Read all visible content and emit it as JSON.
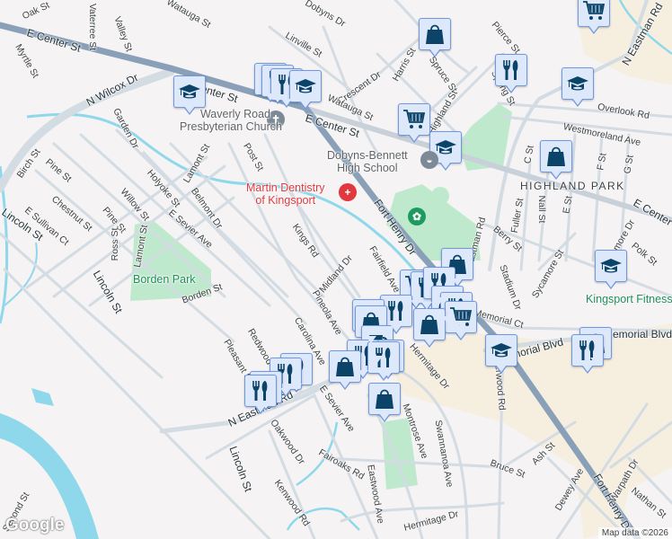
{
  "map": {
    "colors": {
      "background": "#f5f3f3",
      "major_road": "#8aa0b8",
      "minor_road": "#d3dbe3",
      "water": "#8fd8ec",
      "park": "#bfe9cc",
      "commercial": "#f6efe0",
      "marker_bg": "#dde8fb",
      "marker_border": "#6f98e0",
      "marker_icon": "#0b4468"
    },
    "street_labels": [
      "Oak St",
      "Vaterree St",
      "Valley St",
      "Myrtle St",
      "E Center St",
      "N Wilcox Dr",
      "Garden Dr",
      "Center St",
      "Watauga St",
      "Dobyns Dr",
      "Linville St",
      "E Center St",
      "Lamont St",
      "Post St",
      "Birch St",
      "Pine St",
      "Chestnut St",
      "E Sullivan Ct",
      "Lincoln St",
      "Pine St",
      "Willow St",
      "Holyoke St",
      "Belmont Dr",
      "E Sevier Ave",
      "Ross St",
      "Lamont St",
      "Kings Rd",
      "Midland Dr",
      "Borden St",
      "Lincoln St",
      "Crescent Dr",
      "Harris St",
      "Spruce St",
      "Pierce St",
      "Spring St",
      "Watauga St",
      "Highland St",
      "Overlook Rd",
      "Westmoreland Ave",
      "C St",
      "F St",
      "G St",
      "Fuller St",
      "Nall St",
      "E St",
      "Berry St",
      "Fort Henry Dr",
      "Eastman Rd",
      "N Eastman Rd",
      "E Center St",
      "Kenmore Dr",
      "Polk St",
      "Sycamore St",
      "Stadium Dr",
      "Memorial Ct",
      "Memorial Blvd",
      "Memorial Blvd",
      "Fairfield Ave",
      "Pineola Ave",
      "Carolina Ave",
      "Hermitage Dr",
      "Redwood Dr",
      "Pleasant St",
      "N Eastman Rd",
      "E Sevier Ave",
      "Oakwood Dr",
      "Fairoaks Rd",
      "Kenwood Rd",
      "Lincoln St",
      "Eastwood Ave",
      "Montrose Ave",
      "Swannanoa Ave",
      "Bruce St",
      "Ash St",
      "Sherwood Rd",
      "Dewey Ave",
      "Fort Henry Dr",
      "Warpath Dr",
      "Nathan St",
      "Hermitage Dr",
      "Second St"
    ],
    "pois": {
      "church": [
        "Waverly Road",
        "Presbyterian Church"
      ],
      "dentist": [
        "Martin Dentistry",
        "of Kingsport"
      ],
      "school": [
        "Dobyns-Bennett",
        "High School"
      ],
      "park": "Borden Park",
      "fitness": "Kingsport Fitness",
      "neighborhood": "HIGHLAND PARK"
    },
    "markers": [
      "school",
      "restaurant",
      "restaurant",
      "restaurant",
      "school",
      "shopping",
      "grocery",
      "restaurant",
      "school",
      "grocery",
      "school",
      "shopping",
      "school",
      "shopping",
      "grocery",
      "restaurant",
      "restaurant",
      "restaurant",
      "shopping",
      "restaurant",
      "grocery",
      "shopping",
      "shopping",
      "shopping",
      "coffee",
      "restaurant",
      "restaurant",
      "shopping",
      "school",
      "shopping",
      "restaurant",
      "restaurant",
      "restaurant",
      "restaurant",
      "restaurant",
      "restaurant",
      "shopping"
    ],
    "logo": "Google",
    "attribution": "Map data ©2026"
  }
}
